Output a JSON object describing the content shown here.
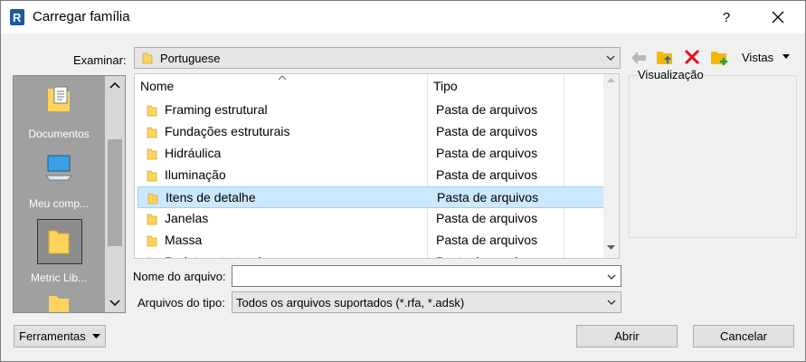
{
  "window": {
    "title": "Carregar família",
    "help_label": "?",
    "close_label": "✕"
  },
  "location": {
    "label": "Examinar:",
    "value": "Portuguese"
  },
  "toolbar": {
    "views_label": "Vistas"
  },
  "preview": {
    "label": "Visualização"
  },
  "places": [
    {
      "label": "Documentos",
      "icon": "documents-icon"
    },
    {
      "label": "Meu comp...",
      "icon": "computer-icon"
    },
    {
      "label": "Metric Lib...",
      "icon": "folder-icon"
    }
  ],
  "filelist": {
    "columns": {
      "name": "Nome",
      "type": "Tipo"
    },
    "rows": [
      {
        "name": "Framing estrutural",
        "type": "Pasta de arquivos"
      },
      {
        "name": "Fundações estruturais",
        "type": "Pasta de arquivos"
      },
      {
        "name": "Hidráulica",
        "type": "Pasta de arquivos"
      },
      {
        "name": "Iluminação",
        "type": "Pasta de arquivos"
      },
      {
        "name": "Itens de detalhe",
        "type": "Pasta de arquivos",
        "selected": true
      },
      {
        "name": "Janelas",
        "type": "Pasta de arquivos"
      },
      {
        "name": "Massa",
        "type": "Pasta de arquivos"
      },
      {
        "name": "Projeto estrutural",
        "type": "Pasta de arquivos"
      }
    ]
  },
  "filename": {
    "label": "Nome do arquivo:",
    "value": ""
  },
  "filetype": {
    "label": "Arquivos do tipo:",
    "value": "Todos os arquivos suportados  (*.rfa, *.adsk)"
  },
  "buttons": {
    "tools": "Ferramentas",
    "open": "Abrir",
    "cancel": "Cancelar"
  },
  "colors": {
    "selection": "#cce8ff",
    "accent_blue": "#1e73be",
    "delete_red": "#e81123",
    "folder_yellow": "#ffd35c"
  }
}
